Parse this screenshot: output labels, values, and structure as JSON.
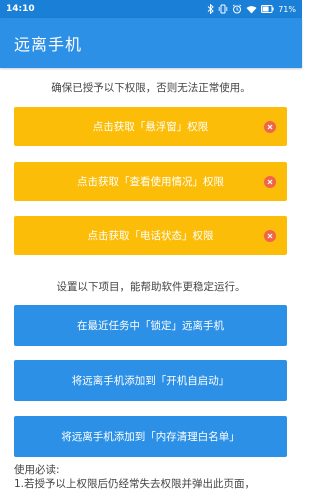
{
  "status_bar": {
    "time": "14:10",
    "battery": "71%"
  },
  "app_bar": {
    "title": "远离手机"
  },
  "notice_required": "确保已授予以下权限，否则无法正常使用。",
  "permissions": [
    {
      "label": "点击获取「悬浮窗」权限",
      "granted": false
    },
    {
      "label": "点击获取「查看使用情况」权限",
      "granted": false
    },
    {
      "label": "点击获取「电话状态」权限",
      "granted": false
    }
  ],
  "notice_optional": "设置以下项目，能帮助软件更稳定运行。",
  "actions": [
    {
      "label": "在最近任务中「锁定」远离手机"
    },
    {
      "label": "将远离手机添加到「开机自启动」"
    },
    {
      "label": "将远离手机添加到「内存清理白名单」"
    }
  ],
  "notes": {
    "heading": "使用必读:",
    "line1": "1.若授予以上权限后仍经常失去权限并弹出此页面，"
  },
  "colors": {
    "status_bar": "#1a7fd6",
    "app_bar": "#2b90e6",
    "permission_button": "#fbbd08",
    "action_button": "#2b90e6",
    "not_granted": "#f0644a"
  },
  "icons": {
    "bluetooth": "bluetooth-icon",
    "alarm": "alarm-icon",
    "wifi": "wifi-icon",
    "battery": "battery-icon",
    "not_granted": "close-circle-icon"
  }
}
